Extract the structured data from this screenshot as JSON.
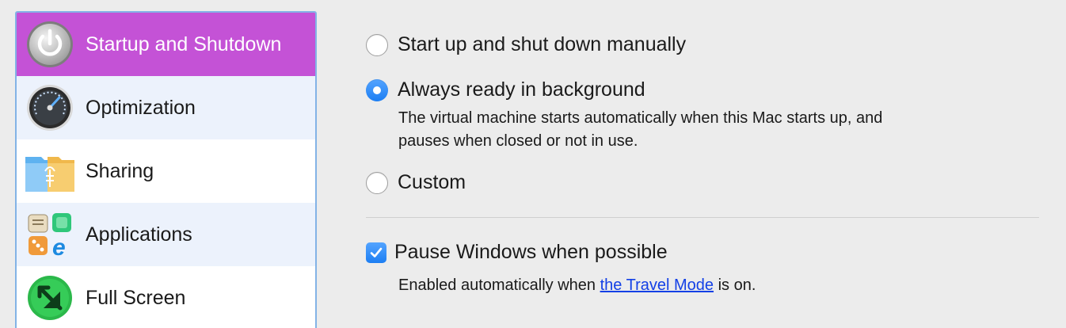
{
  "sidebar": {
    "items": [
      {
        "label": "Startup and Shutdown",
        "icon": "power-icon",
        "selected": true
      },
      {
        "label": "Optimization",
        "icon": "speedometer-icon"
      },
      {
        "label": "Sharing",
        "icon": "shared-folder-icon"
      },
      {
        "label": "Applications",
        "icon": "applications-icon"
      },
      {
        "label": "Full Screen",
        "icon": "full-screen-icon"
      }
    ]
  },
  "startup": {
    "options": [
      {
        "label": "Start up and shut down manually",
        "selected": false
      },
      {
        "label": "Always ready in background",
        "selected": true,
        "description_line1": "The virtual machine starts automatically when this Mac starts up, and",
        "description_line2": "pauses when closed or not in use."
      },
      {
        "label": "Custom",
        "selected": false
      }
    ]
  },
  "pause": {
    "label": "Pause Windows when possible",
    "checked": true,
    "note_prefix": "Enabled automatically when ",
    "note_link": "the Travel Mode",
    "note_suffix": " is on."
  },
  "colors": {
    "selection": "#c452d6",
    "accent": "#1c7ef3",
    "link": "#1340e6",
    "sidebar_border": "#83b3e6"
  }
}
